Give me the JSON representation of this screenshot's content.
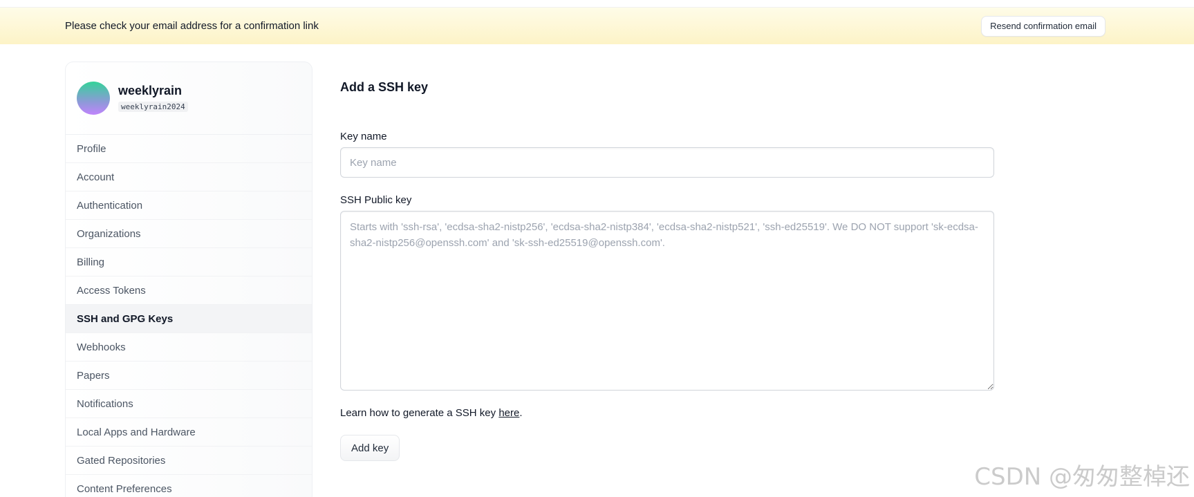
{
  "banner": {
    "message": "Please check your email address for a confirmation link",
    "resend_label": "Resend confirmation email"
  },
  "user": {
    "name": "weeklyrain",
    "handle": "weeklyrain2024"
  },
  "sidebar": {
    "items": [
      {
        "label": "Profile",
        "active": false
      },
      {
        "label": "Account",
        "active": false
      },
      {
        "label": "Authentication",
        "active": false
      },
      {
        "label": "Organizations",
        "active": false
      },
      {
        "label": "Billing",
        "active": false
      },
      {
        "label": "Access Tokens",
        "active": false
      },
      {
        "label": "SSH and GPG Keys",
        "active": true
      },
      {
        "label": "Webhooks",
        "active": false
      },
      {
        "label": "Papers",
        "active": false
      },
      {
        "label": "Notifications",
        "active": false
      },
      {
        "label": "Local Apps and Hardware",
        "active": false
      },
      {
        "label": "Gated Repositories",
        "active": false
      },
      {
        "label": "Content Preferences",
        "active": false
      }
    ]
  },
  "form": {
    "title": "Add a SSH key",
    "key_name_label": "Key name",
    "key_name_placeholder": "Key name",
    "key_name_value": "",
    "ssh_label": "SSH Public key",
    "ssh_placeholder": "Starts with 'ssh-rsa', 'ecdsa-sha2-nistp256', 'ecdsa-sha2-nistp384', 'ecdsa-sha2-nistp521', 'ssh-ed25519'. We DO NOT support 'sk-ecdsa-sha2-nistp256@openssh.com' and 'sk-ssh-ed25519@openssh.com'.",
    "ssh_value": "",
    "learn_prefix": "Learn how to generate a SSH key ",
    "learn_link": "here",
    "learn_suffix": ".",
    "add_label": "Add key"
  },
  "watermark": "CSDN @匆匆整棹还",
  "colors": {
    "banner_bg": "#fdf3c7",
    "active_nav_bg": "#f3f4f6",
    "text_primary": "#111827",
    "text_secondary": "#4b5563"
  }
}
